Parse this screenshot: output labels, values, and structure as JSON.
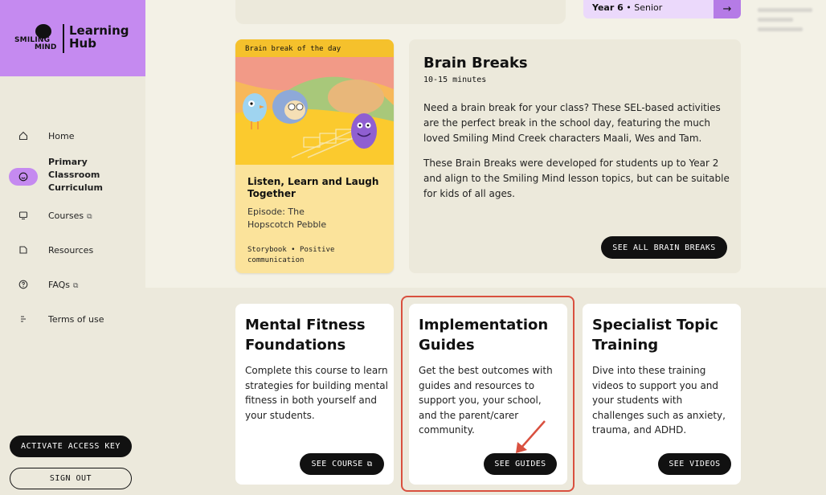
{
  "sidebar": {
    "logo": {
      "line1": "SMILING",
      "line2": "MIND",
      "title": "Learning Hub"
    },
    "items": [
      {
        "label": "Home",
        "icon": "home-icon"
      },
      {
        "label": "Primary Classroom Curriculum",
        "icon": "smiley-icon"
      },
      {
        "label": "Courses",
        "icon": "monitor-icon",
        "ext": "⧉"
      },
      {
        "label": "Resources",
        "icon": "folder-icon"
      },
      {
        "label": "FAQs",
        "icon": "question-icon",
        "ext": "⧉"
      },
      {
        "label": "Terms of use",
        "icon": "list-icon"
      }
    ],
    "activate_label": "ACTIVATE ACCESS KEY",
    "signout_label": "SIGN OUT"
  },
  "header": {
    "year": "Year 6",
    "year_level": "• Senior",
    "arrow": "→"
  },
  "brain_break": {
    "tag": "Brain break of the day",
    "title": "Listen, Learn and Laugh Together",
    "episode": "Episode: The Hopscotch Pebble",
    "meta": "Storybook • Positive communication"
  },
  "brain_breaks_info": {
    "title": "Brain Breaks",
    "duration": "10-15 minutes",
    "p1": "Need a brain break for your class? These SEL-based activities are the perfect break in the school day, featuring the much loved Smiling Mind Creek characters Maali, Wes and Tam.",
    "p2": "These Brain Breaks were developed for students up to Year 2 and align to the Smiling Mind lesson topics, but can be suitable for kids of all ages.",
    "button": "SEE ALL BRAIN BREAKS"
  },
  "cards": [
    {
      "title": "Mental Fitness Foundations",
      "body": "Complete this course to learn strategies for building mental fitness in both yourself and your students.",
      "button": "SEE COURSE",
      "ext": "⧉"
    },
    {
      "title": "Implementation Guides",
      "body": "Get the best outcomes with guides and resources to support you, your school, and the parent/carer community.",
      "button": "SEE GUIDES"
    },
    {
      "title": "Specialist Topic Training",
      "body": "Dive into these training videos to support you and your students with challenges such as anxiety, trauma, and ADHD.",
      "button": "SEE VIDEOS"
    }
  ],
  "colors": {
    "brand_purple": "#c58af0",
    "highlight_red": "#d9503f",
    "card_yellow": "#fbe39b"
  }
}
